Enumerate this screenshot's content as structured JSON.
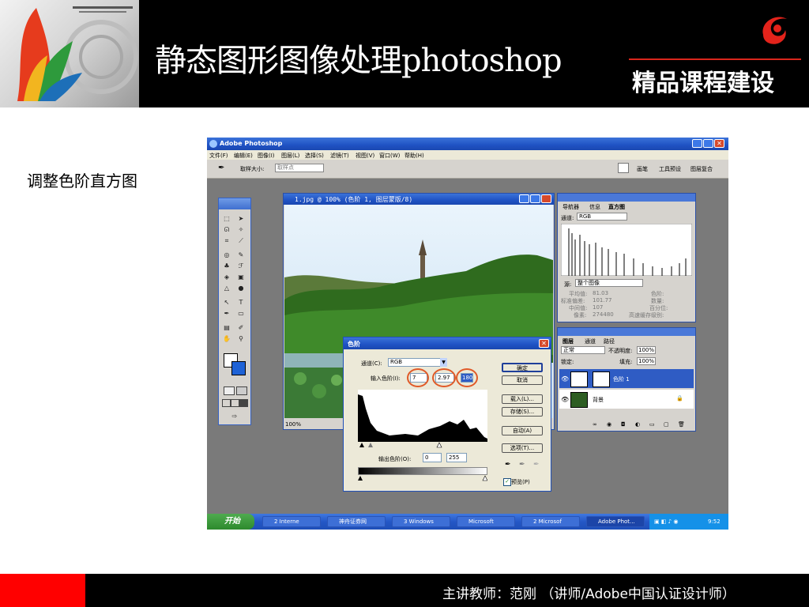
{
  "slide": {
    "header_title": "静态图形图像处理photoshop",
    "header_subtitle": "精品课程建设",
    "side_caption": "调整色阶直方图",
    "footer_text": "主讲教师：范刚  （讲师/Adobe中国认证设计师）",
    "colors": {
      "header_bg": "#000000",
      "accent_red": "#ff0000",
      "brand_red": "#d9261c"
    }
  },
  "photoshop": {
    "window_title": "Adobe Photoshop",
    "menu": [
      "文件(F)",
      "编辑(E)",
      "图像(I)",
      "图层(L)",
      "选择(S)",
      "滤镜(T)",
      "视图(V)",
      "窗口(W)",
      "帮助(H)"
    ],
    "options_bar": {
      "label": "取样大小:",
      "value": "取样点"
    },
    "palette_well_tabs": [
      "画笔",
      "工具预设",
      "图层复合"
    ],
    "document": {
      "title": "1.jpg @ 100% (色阶 1, 图层蒙版/8)",
      "zoom": "100%"
    },
    "histogram_panel": {
      "tabs": [
        "导航器",
        "信息",
        "直方图"
      ],
      "channel_label": "通道:",
      "channel_value": "RGB",
      "source_label": "源:",
      "source_value": "整个图像",
      "stats": [
        {
          "label": "平均值:",
          "value": "81.03"
        },
        {
          "label": "标准偏差:",
          "value": "101.77"
        },
        {
          "label": "中间值:",
          "value": "107"
        },
        {
          "label": "像素:",
          "value": "274480"
        }
      ],
      "stats_right": [
        "色阶:",
        "数量:",
        "百分位:",
        "高速缓存级别:"
      ]
    },
    "layers_panel": {
      "tabs": [
        "图层",
        "通道",
        "路径"
      ],
      "blend_mode": "正常",
      "opacity_label": "不透明度:",
      "opacity": "100%",
      "fill_label": "填充:",
      "fill": "100%",
      "lock_label": "锁定:",
      "layers": [
        {
          "name": "色阶 1",
          "selected": true
        },
        {
          "name": "背景",
          "selected": false
        }
      ]
    },
    "levels_dialog": {
      "title": "色阶",
      "channel_label": "通道(C):",
      "channel_value": "RGB",
      "input_label": "输入色阶(I):",
      "input_black": "7",
      "input_gamma": "2.97",
      "input_white": "180",
      "output_label": "输出色阶(O):",
      "output_black": "0",
      "output_white": "255",
      "buttons": [
        "确定",
        "取消",
        "载入(L)...",
        "存储(S)...",
        "自动(A)",
        "选项(T)..."
      ],
      "preview_label": "预览(P)",
      "preview_checked": true
    },
    "taskbar": {
      "start_label": "开始",
      "items": [
        "2 Interne",
        "神舟证券网",
        "3 Windows",
        "Microsoft",
        "2 Microsof",
        "Adobe Phot..."
      ],
      "clock": "9:52"
    }
  }
}
